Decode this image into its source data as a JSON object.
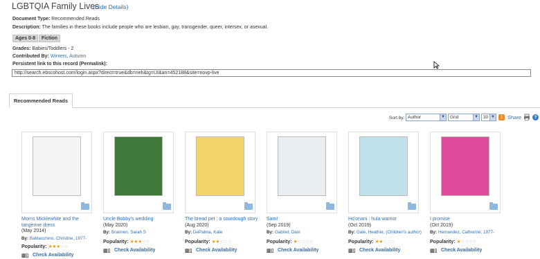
{
  "header": {
    "title": "LGBTQIA Family Lives",
    "hide_details": "(Hide Details)"
  },
  "details": {
    "doc_type_label": "Document Type:",
    "doc_type_value": "Recommended Reads",
    "description_label": "Description:",
    "description_value": "The families in these books include people who are lesbian, gay, transgender, queer, intersex, or asexual.",
    "chips": [
      "Ages 0-8",
      "Fiction"
    ],
    "grades_label": "Grades:",
    "grades_value": "Babies/Toddlers - 2",
    "contributed_label": "Contributed By:",
    "contributed_value": "Winters, Autumn",
    "permalink_label": "Persistent link to this record (Permalink):",
    "permalink_value": "http://search.ebscohost.com/login.aspx?direct=true&db=neh&tg=UI&an=452188&site=novp-live"
  },
  "tabs": {
    "active": "Recommended Reads"
  },
  "toolbar": {
    "sort_by_label": "Sort by:",
    "sort_value": "Author",
    "view_value": "Grid",
    "per_page_value": "30",
    "share_label": "Share",
    "rss_icon": "rss-icon",
    "print_icon": "print-icon",
    "help_icon": "help-icon"
  },
  "books": [
    {
      "title": "Morris Micklewhite and the tangerine dress",
      "date": "(May 2014)",
      "by_label": "By:",
      "author": "Baldacchino, Christine, 1977-",
      "popularity_label": "Popularity:",
      "stars": 3,
      "availability": "Check Availability",
      "cover_color": "#f4f4f4"
    },
    {
      "title": "Uncle Bobby's wedding",
      "date": "(May 2020)",
      "by_label": "By:",
      "author": "Brannen, Sarah S",
      "popularity_label": "Popularity:",
      "stars": 3,
      "availability": "Check Availability",
      "cover_color": "#3f7a3a"
    },
    {
      "title": "The bread pet : a sourdough story",
      "date": "(Aug 2020)",
      "by_label": "By:",
      "author": "DePalma, Kate",
      "popularity_label": "Popularity:",
      "stars": 2,
      "availability": "Check Availability",
      "cover_color": "#f2d36b"
    },
    {
      "title": "Sam!",
      "date": "(Sep 2019)",
      "by_label": "By:",
      "author": "Gabriel, Dani",
      "popularity_label": "Popularity:",
      "stars": 1,
      "availability": "Check Availability",
      "cover_color": "#e9eef0"
    },
    {
      "title": "Ho'onani : hula warrior",
      "date": "(Oct 2019)",
      "by_label": "By:",
      "author": "Gale, Heather, (Children's author)",
      "popularity_label": "Popularity:",
      "stars": 2,
      "availability": "Check Availability",
      "cover_color": "#bfe2ea"
    },
    {
      "title": "I promise",
      "date": "(Oct 2019)",
      "by_label": "By:",
      "author": "Hernandez, Catherine, 1977-",
      "popularity_label": "Popularity:",
      "stars": 1,
      "availability": "Check Availability",
      "cover_color": "#e04a9a"
    }
  ]
}
